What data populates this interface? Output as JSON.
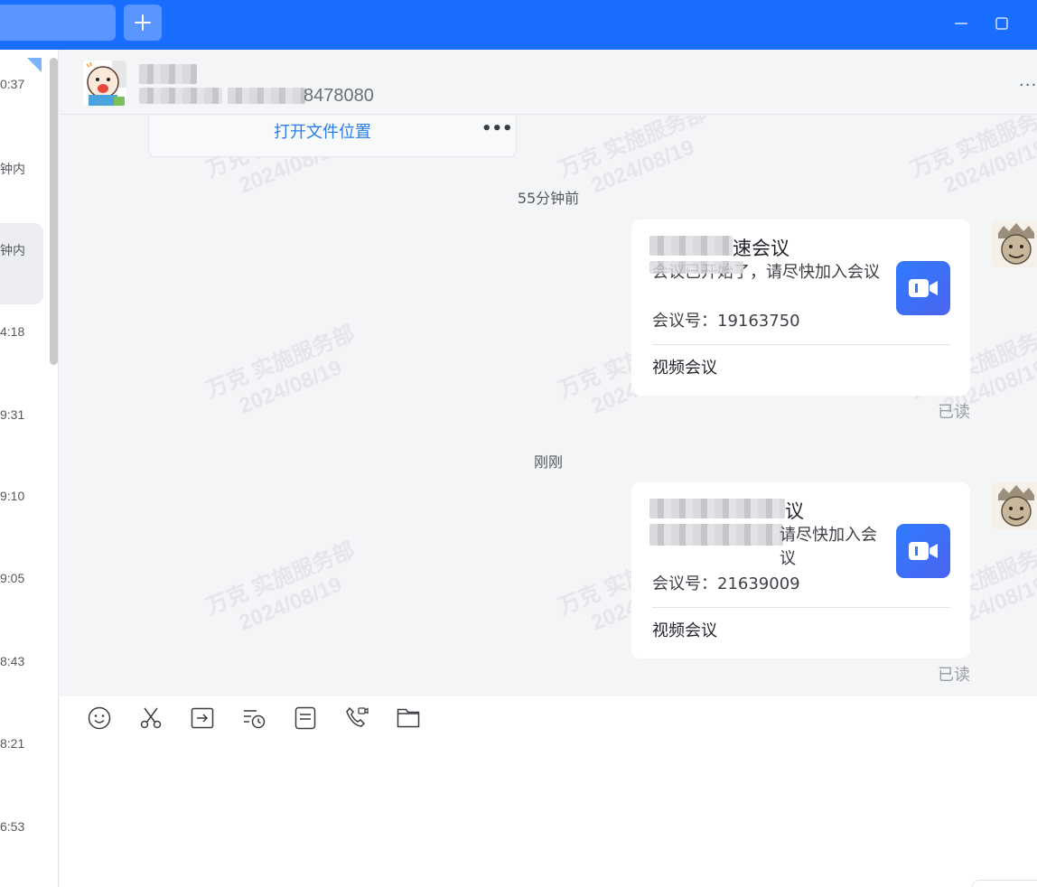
{
  "titlebar": {
    "add_icon": "plus-icon",
    "minimize_icon": "minimize-icon",
    "maximize_icon": "maximize-icon"
  },
  "session_list": {
    "times": [
      "0:37",
      "钟内",
      "钟内",
      "4:18",
      "9:31",
      "9:10",
      "9:05",
      "8:43",
      "8:21",
      "6:53"
    ]
  },
  "chat_header": {
    "contact_id_suffix": "8478080",
    "more_label": "..."
  },
  "watermark": {
    "line1": "万克 实施服务部",
    "line2": "2024/08/19"
  },
  "messages": {
    "file_card": {
      "open_location": "打开文件位置",
      "more": "•••"
    },
    "separators": [
      "55分钟前",
      "刚刚"
    ],
    "meetings": [
      {
        "title_visible": "速会议",
        "desc": "会议已开始了，请尽快加入会议",
        "number_label": "会议号：",
        "number": "19163750",
        "footer": "视频会议",
        "status": "已读"
      },
      {
        "title_visible": "议",
        "desc_visible": "请尽快加入会议",
        "number_label": "会议号：",
        "number": "21639009",
        "footer": "视频会议",
        "status": "已读"
      }
    ]
  },
  "toolbar": {
    "tools": [
      "emoji-icon",
      "scissors-icon",
      "send-file-icon",
      "history-icon",
      "notes-icon",
      "call-icon",
      "folder-icon"
    ]
  },
  "colors": {
    "brand": "#1a6eff",
    "link": "#2b7de9",
    "meeting_icon": "#2f7bff"
  }
}
